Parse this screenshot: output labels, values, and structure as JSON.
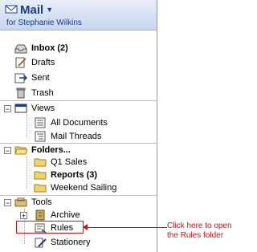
{
  "header": {
    "title": "Mail",
    "subtitle": "for Stephanie Wilkins"
  },
  "items": {
    "inbox": "Inbox (2)",
    "drafts": "Drafts",
    "sent": "Sent",
    "trash": "Trash",
    "views": "Views",
    "all_documents": "All Documents",
    "mail_threads": "Mail Threads",
    "folders": "Folders...",
    "q1_sales": "Q1 Sales",
    "reports": "Reports (3)",
    "weekend_sailing": "Weekend Sailing",
    "tools": "Tools",
    "archive": "Archive",
    "rules": "Rules",
    "stationery": "Stationery"
  },
  "callout": "Click here to open the Rules folder",
  "colors": {
    "accent": "#1a3f8c",
    "annotation": "#d01010"
  }
}
